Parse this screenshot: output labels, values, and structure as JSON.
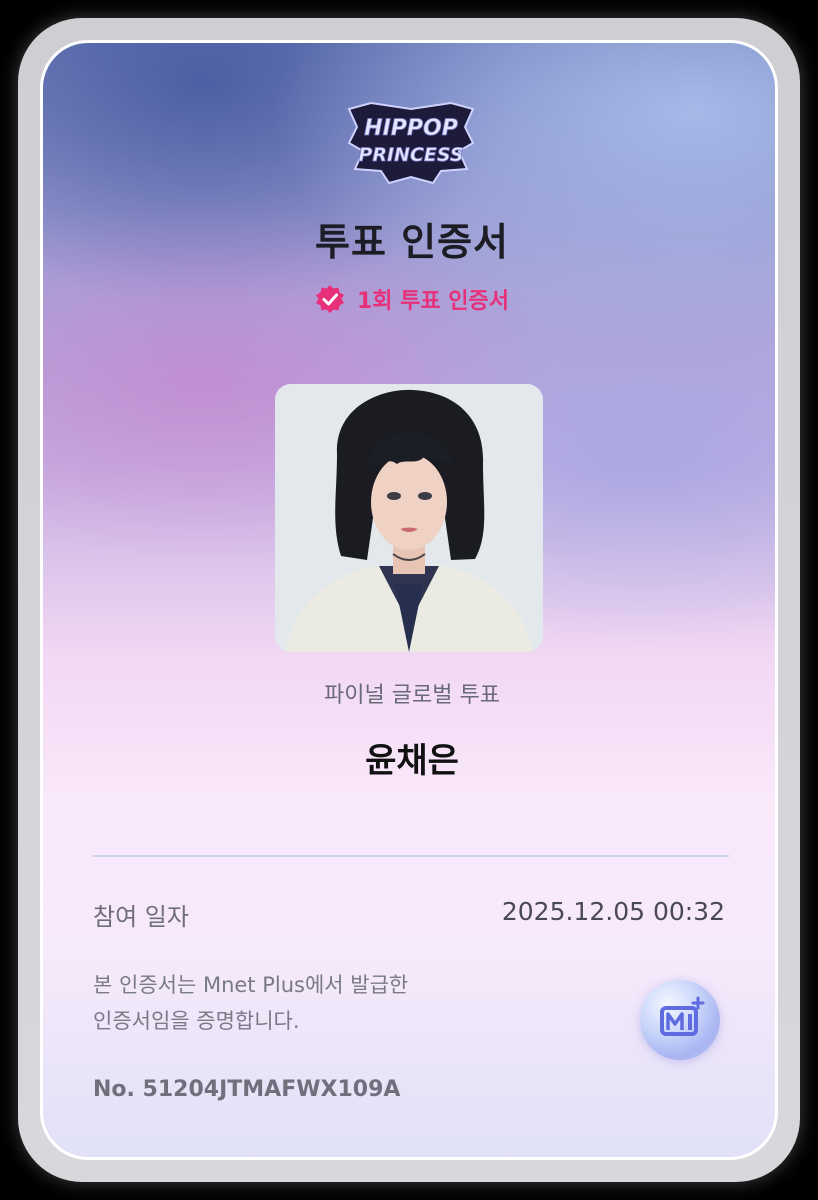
{
  "certificate": {
    "logo_text_line1": "HIPPOP",
    "logo_text_line2": "PRINCESS",
    "title": "투표 인증서",
    "badge_label": "1회 투표 인증서",
    "photo_icon": "portrait-photo",
    "event_name": "파이널 글로벌 투표",
    "candidate_name": "윤채은",
    "date_label": "참여 일자",
    "date_value": "2025.12.05 00:32",
    "notice_line1": "본 인증서는 Mnet Plus에서 발급한",
    "notice_line2": "인증서임을 증명합니다.",
    "serial_number": "No. 51204JTMAFWX109A",
    "issuer_icon": "mnet-plus-logo-icon",
    "colors": {
      "badge_pink": "#e8307a",
      "title_dark": "#1c1c24"
    }
  }
}
